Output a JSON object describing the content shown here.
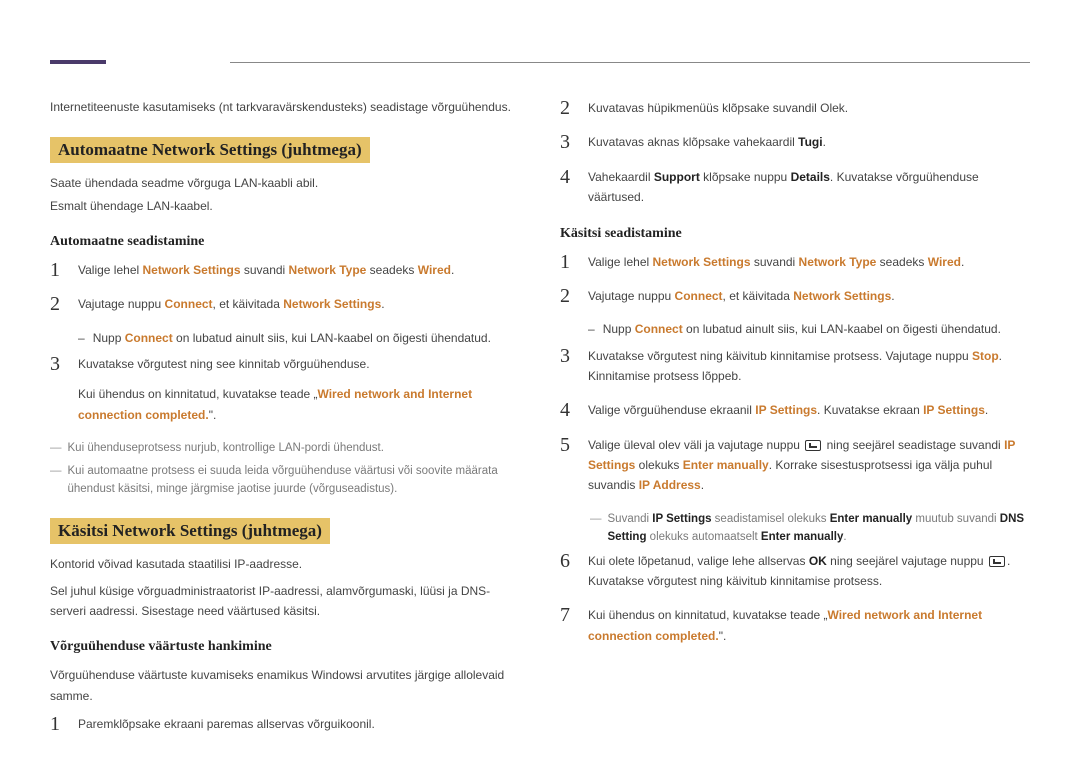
{
  "intro": "Internetiteenuste kasutamiseks (nt tarkvaravärskendusteks) seadistage võrguühendus.",
  "section1": {
    "title": "Automaatne Network Settings (juhtmega)",
    "lines": [
      "Saate ühendada seadme võrguga LAN-kaabli abil.",
      "Esmalt ühendage LAN-kaabel."
    ],
    "subtitle": "Automaatne seadistamine",
    "steps": {
      "s1_pre": "Valige lehel ",
      "s1_o1": "Network Settings",
      "s1_mid1": " suvandi ",
      "s1_o2": "Network Type",
      "s1_mid2": " seadeks ",
      "s1_o3": "Wired",
      "s1_end": ".",
      "s2_pre": "Vajutage nuppu ",
      "s2_o1": "Connect",
      "s2_mid": ", et käivitada ",
      "s2_o2": "Network Settings",
      "s2_end": ".",
      "s2_dash_pre": "Nupp ",
      "s2_dash_o": "Connect",
      "s2_dash_post": " on lubatud ainult siis, kui LAN-kaabel on õigesti ühendatud.",
      "s3_line1": "Kuvatakse võrgutest ning see kinnitab võrguühenduse.",
      "s3_line2_pre": "Kui ühendus on kinnitatud, kuvatakse teade „",
      "s3_line2_o": "Wired network and Internet connection completed.",
      "s3_line2_post": "\".",
      "note1": "Kui ühenduseprotsess nurjub, kontrollige LAN-pordi ühendust.",
      "note2": "Kui automaatne protsess ei suuda leida võrguühenduse väärtusi või soovite määrata ühendust käsitsi, minge järgmise jaotise juurde (võrguseadistus)."
    }
  },
  "section2": {
    "title": "Käsitsi Network Settings (juhtmega)",
    "lines": [
      "Kontorid võivad kasutada staatilisi IP-aadresse.",
      "Sel juhul küsige võrguadministraatorist IP-aadressi, alamvõrgumaski, lüüsi ja DNS-serveri aadressi. Sisestage need väärtused käsitsi."
    ],
    "subtitle": "Võrguühenduse väärtuste hankimine",
    "sublead": "Võrguühenduse väärtuste kuvamiseks enamikus Windowsi arvutites järgige allolevaid samme.",
    "step1": "Paremklõpsake ekraani paremas allservas võrguikoonil."
  },
  "right": {
    "step2": "Kuvatavas hüpikmenüüs klõpsake suvandil Olek.",
    "step3_pre": "Kuvatavas aknas klõpsake vahekaardil ",
    "step3_b": "Tugi",
    "step3_end": ".",
    "step4_pre": "Vahekaardil ",
    "step4_b1": "Support",
    "step4_mid": " klõpsake nuppu ",
    "step4_b2": "Details",
    "step4_end": ". Kuvatakse võrguühenduse väärtused.",
    "subtitle": "Käsitsi seadistamine",
    "r1_pre": "Valige lehel ",
    "r1_o1": "Network Settings",
    "r1_mid1": " suvandi ",
    "r1_o2": "Network Type",
    "r1_mid2": " seadeks ",
    "r1_o3": "Wired",
    "r1_end": ".",
    "r2_pre": "Vajutage nuppu ",
    "r2_o1": "Connect",
    "r2_mid": ", et käivitada ",
    "r2_o2": "Network Settings",
    "r2_end": ".",
    "r2_dash_pre": "Nupp ",
    "r2_dash_o": "Connect",
    "r2_dash_post": " on lubatud ainult siis, kui LAN-kaabel on õigesti ühendatud.",
    "r3_pre": "Kuvatakse võrgutest ning käivitub kinnitamise protsess. Vajutage nuppu ",
    "r3_o": "Stop",
    "r3_post": ". Kinnitamise protsess lõppeb.",
    "r4_pre": "Valige võrguühenduse ekraanil ",
    "r4_o1": "IP Settings",
    "r4_mid": ". Kuvatakse ekraan ",
    "r4_o2": "IP Settings",
    "r4_end": ".",
    "r5_pre": "Valige üleval olev väli ja vajutage nuppu ",
    "r5_mid": " ning seejärel seadistage suvandi ",
    "r5_o1": "IP Settings",
    "r5_mid2": " olekuks ",
    "r5_o2": "Enter manually",
    "r5_mid3": ". Korrake sisestusprotsessi iga välja puhul suvandis ",
    "r5_o3": "IP Address",
    "r5_end": ".",
    "r5_note_pre": "Suvandi ",
    "r5_note_o1": "IP Settings",
    "r5_note_mid1": " seadistamisel olekuks ",
    "r5_note_o2": "Enter manually",
    "r5_note_mid2": " muutub suvandi ",
    "r5_note_o3": "DNS Setting",
    "r5_note_mid3": " olekuks automaatselt ",
    "r5_note_o4": "Enter manually",
    "r5_note_end": ".",
    "r6_pre": "Kui olete lõpetanud, valige lehe allservas ",
    "r6_b": "OK",
    "r6_mid": " ning seejärel vajutage nuppu ",
    "r6_post": ". Kuvatakse võrgutest ning käivitub kinnitamise protsess.",
    "r7_pre": "Kui ühendus on kinnitatud, kuvatakse teade „",
    "r7_o": "Wired network and Internet connection completed.",
    "r7_post": "\"."
  }
}
